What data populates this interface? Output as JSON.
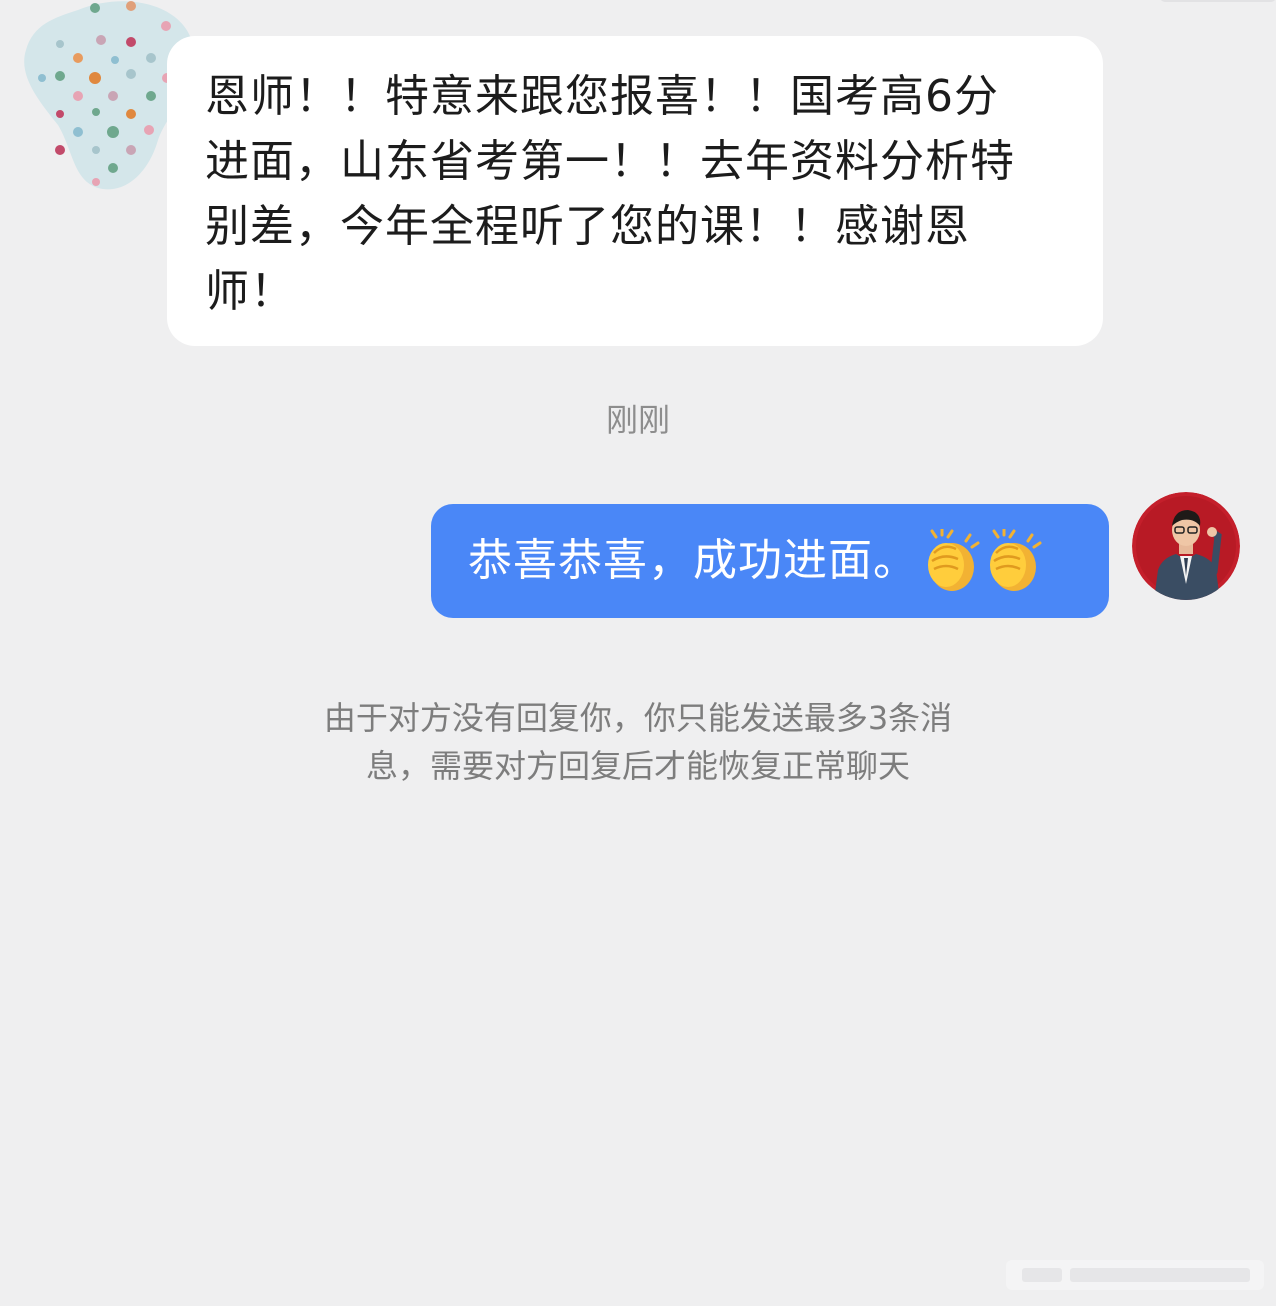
{
  "incoming": {
    "avatar_icon": "polka-dot-avatar",
    "lines": [
      "恩师！！特意来跟您报喜！！国考高6分",
      "进面，山东省考第一！！去年资料分析特",
      "别差，今年全程听了您的课！！感谢恩",
      "师！"
    ]
  },
  "timestamp": "刚刚",
  "outgoing": {
    "text": "恭喜恭喜，成功进面。",
    "emoji_icons": [
      "clapping-hands-emoji",
      "clapping-hands-emoji"
    ],
    "avatar_icon": "teacher-avatar"
  },
  "notice": {
    "lines": [
      "由于对方没有回复你，你只能发送最多3条消",
      "息，需要对方回复后才能恢复正常聊天"
    ]
  },
  "colors": {
    "background": "#efeff0",
    "incoming_bubble": "#ffffff",
    "outgoing_bubble": "#4a87f7",
    "avatar_red": "#c41f2b"
  }
}
